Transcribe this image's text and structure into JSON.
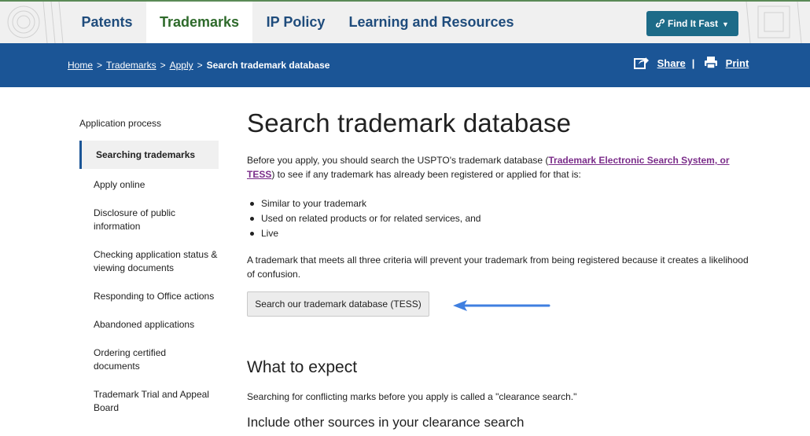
{
  "topnav": {
    "tabs": [
      {
        "label": "Patents",
        "active": false
      },
      {
        "label": "Trademarks",
        "active": true
      },
      {
        "label": "IP Policy",
        "active": false
      },
      {
        "label": "Learning and Resources",
        "active": false
      }
    ],
    "find_it_fast": "Find It Fast"
  },
  "breadcrumb": {
    "items": [
      "Home",
      "Trademarks",
      "Apply"
    ],
    "current": "Search trademark database",
    "separator": ">"
  },
  "tools": {
    "share": "Share",
    "divider": "|",
    "print": "Print"
  },
  "sidebar": {
    "title": "Application process",
    "items": [
      {
        "label": "Searching trademarks",
        "active": true
      },
      {
        "label": "Apply online"
      },
      {
        "label": "Disclosure of public information"
      },
      {
        "label": "Checking application status & viewing documents"
      },
      {
        "label": "Responding to Office actions"
      },
      {
        "label": "Abandoned applications"
      },
      {
        "label": "Ordering certified documents"
      },
      {
        "label": "Trademark Trial and Appeal Board"
      }
    ]
  },
  "main": {
    "title": "Search trademark database",
    "intro_before": "Before you apply, you should search the USPTO's trademark database (",
    "intro_link": "Trademark Electronic Search System, or TESS",
    "intro_after": ") to see if any trademark has already been registered or applied for that is:",
    "bullets": [
      "Similar to your trademark",
      "Used on related products or for related services, and",
      "Live"
    ],
    "criteria_text": "A trademark that meets all three criteria will prevent your trademark from being registered because it creates a likelihood of confusion.",
    "button_label": "Search our trademark database (TESS)",
    "expect_heading": "What to expect",
    "expect_text": "Searching for conflicting marks before you apply is called a \"clearance search.\"",
    "other_sources_heading": "Include other sources in your clearance search"
  },
  "colors": {
    "nav_text": "#1f4c7c",
    "active_tab_text": "#2e6a2b",
    "crumb_bar": "#1b5596",
    "find_fast_button": "#1d6b88",
    "link_visited": "#7b2d8a",
    "annotation_arrow": "#3f7fe0"
  }
}
